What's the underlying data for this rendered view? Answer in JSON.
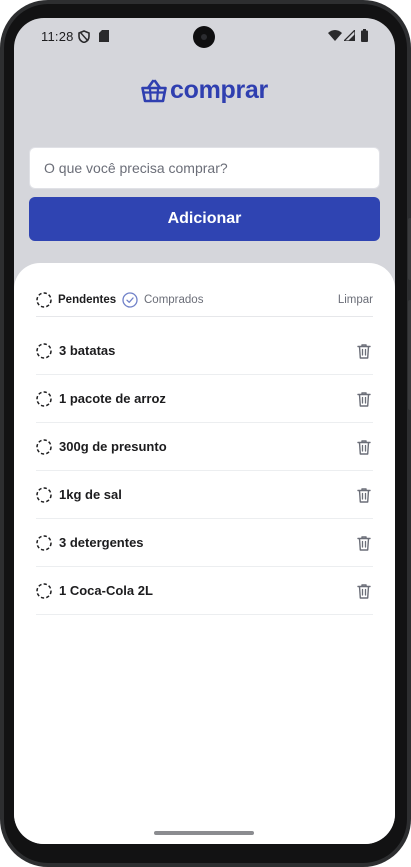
{
  "status_bar": {
    "time": "11:28"
  },
  "app": {
    "logo_text": "comprar",
    "brand_color": "#2f44b2"
  },
  "form": {
    "input_placeholder": "O que você precisa comprar?",
    "input_value": "",
    "add_button_label": "Adicionar"
  },
  "filters": {
    "pending_label": "Pendentes",
    "bought_label": "Comprados",
    "clear_label": "Limpar",
    "active": "pending"
  },
  "items": [
    {
      "label": "3 batatas",
      "status": "pending"
    },
    {
      "label": "1 pacote de arroz",
      "status": "pending"
    },
    {
      "label": "300g de presunto",
      "status": "pending"
    },
    {
      "label": "1kg de sal",
      "status": "pending"
    },
    {
      "label": "3 detergentes",
      "status": "pending"
    },
    {
      "label": "1 Coca-Cola 2L",
      "status": "pending"
    }
  ],
  "icons": {
    "status": [
      "shield-icon",
      "sd-card-icon",
      "wifi-icon",
      "signal-icon",
      "battery-icon"
    ],
    "logo": "basket-icon",
    "item_status": "dashed-circle-icon",
    "item_action": "trash-icon",
    "bought_filter": "check-circle-icon"
  }
}
